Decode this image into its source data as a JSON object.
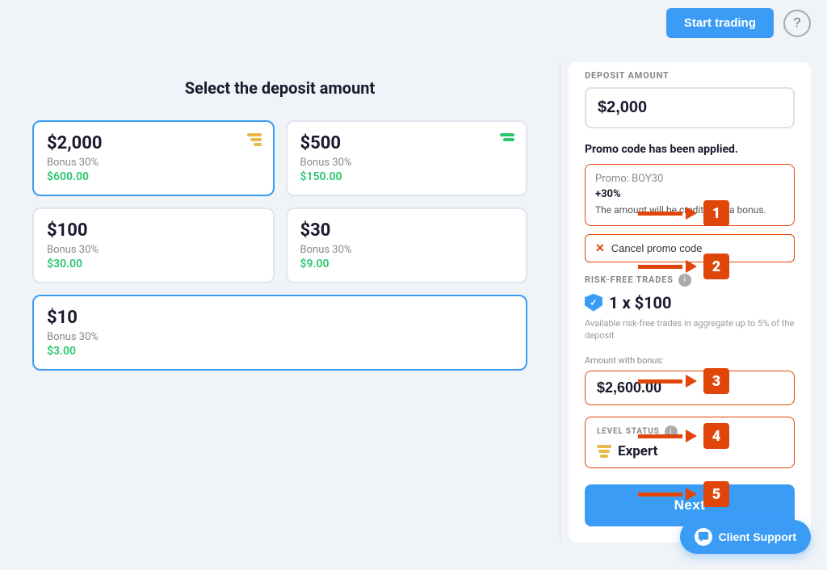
{
  "topbar": {
    "start_trading_label": "Start trading",
    "help_icon": "?"
  },
  "left_panel": {
    "title": "Select the deposit amount",
    "cards": [
      {
        "amount": "$2,000",
        "bonus_label": "Bonus 30%",
        "bonus_value": "$600.00",
        "selected": true,
        "icon_type": "gold"
      },
      {
        "amount": "$500",
        "bonus_label": "Bonus 30%",
        "bonus_value": "$150.00",
        "selected": false,
        "icon_type": "green"
      },
      {
        "amount": "$100",
        "bonus_label": "Bonus 30%",
        "bonus_value": "$30.00",
        "selected": false,
        "icon_type": "none"
      },
      {
        "amount": "$30",
        "bonus_label": "Bonus 30%",
        "bonus_value": "$9.00",
        "selected": false,
        "icon_type": "none"
      },
      {
        "amount": "$10",
        "bonus_label": "Bonus 30%",
        "bonus_value": "$3.00",
        "selected": true,
        "icon_type": "none"
      }
    ]
  },
  "right_panel": {
    "deposit_amount_label": "DEPOSIT AMOUNT",
    "deposit_amount_value": "$2,000",
    "promo_applied_text": "Promo code has been applied.",
    "promo_box": {
      "code_label": "Promo: BOY30",
      "percent": "+30%",
      "description": "The amount will be credited as a bonus."
    },
    "cancel_promo_label": "Cancel promo code",
    "risk_free_label": "RISK-FREE TRADES",
    "risk_free_value": "1 x $100",
    "risk_free_note": "Available risk-free trades in aggregate up to 5% of the deposit",
    "amount_bonus_label": "Amount with bonus:",
    "amount_bonus_value": "$2,600.00",
    "level_status_label": "LEVEL STATUS",
    "level_status_value": "Expert",
    "next_label": "Next"
  },
  "annotations": [
    {
      "number": "1",
      "label": "promo-box-arrow"
    },
    {
      "number": "2",
      "label": "cancel-promo-arrow"
    },
    {
      "number": "3",
      "label": "amount-bonus-arrow"
    },
    {
      "number": "4",
      "label": "level-status-arrow"
    },
    {
      "number": "5",
      "label": "next-button-arrow"
    }
  ],
  "client_support": {
    "label": "Client Support"
  }
}
